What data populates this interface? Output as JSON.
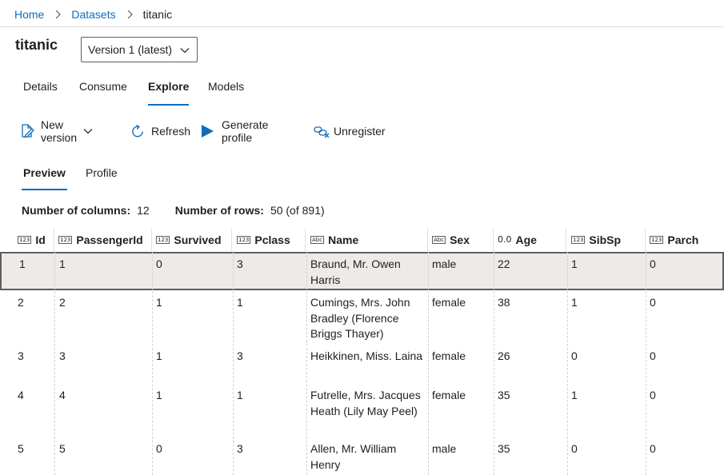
{
  "breadcrumb": {
    "home": "Home",
    "datasets": "Datasets",
    "current": "titanic"
  },
  "title": "titanic",
  "version": "Version 1 (latest)",
  "tabs": [
    {
      "label": "Details",
      "active": false
    },
    {
      "label": "Consume",
      "active": false
    },
    {
      "label": "Explore",
      "active": true
    },
    {
      "label": "Models",
      "active": false
    }
  ],
  "toolbar": {
    "new_version": "New version",
    "refresh": "Refresh",
    "generate_profile": "Generate profile",
    "unregister": "Unregister"
  },
  "subtabs": [
    {
      "label": "Preview",
      "active": true
    },
    {
      "label": "Profile",
      "active": false
    }
  ],
  "counts": {
    "columns_label": "Number of columns:",
    "columns_value": "12",
    "rows_label": "Number of rows:",
    "rows_value": "50 (of 891)"
  },
  "table": {
    "columns": [
      {
        "name": "Id",
        "type_icon": "123"
      },
      {
        "name": "PassengerId",
        "type_icon": "123"
      },
      {
        "name": "Survived",
        "type_icon": "123"
      },
      {
        "name": "Pclass",
        "type_icon": "123"
      },
      {
        "name": "Name",
        "type_icon": "Abc"
      },
      {
        "name": "Sex",
        "type_icon": "Abc"
      },
      {
        "name": "Age",
        "type_icon": "0.0"
      },
      {
        "name": "SibSp",
        "type_icon": "123"
      },
      {
        "name": "Parch",
        "type_icon": "123"
      }
    ],
    "rows": [
      {
        "selected": true,
        "cells": [
          "1",
          "1",
          "0",
          "3",
          "Braund, Mr. Owen Harris",
          "male",
          "22",
          "1",
          "0"
        ]
      },
      {
        "selected": false,
        "cells": [
          "2",
          "2",
          "1",
          "1",
          "Cumings, Mrs. John Bradley (Florence Briggs Thayer)",
          "female",
          "38",
          "1",
          "0"
        ]
      },
      {
        "selected": false,
        "cells": [
          "3",
          "3",
          "1",
          "3",
          "Heikkinen, Miss. Laina",
          "female",
          "26",
          "0",
          "0"
        ]
      },
      {
        "selected": false,
        "cells": [
          "4",
          "4",
          "1",
          "1",
          "Futrelle, Mrs. Jacques Heath (Lily May Peel)",
          "female",
          "35",
          "1",
          "0"
        ]
      },
      {
        "selected": false,
        "cells": [
          "5",
          "5",
          "0",
          "3",
          "Allen, Mr. William Henry",
          "male",
          "35",
          "0",
          "0"
        ]
      }
    ]
  },
  "colors": {
    "accent": "#0f6cbd",
    "selected_row": "#edebe9",
    "text": "#201f1e"
  }
}
